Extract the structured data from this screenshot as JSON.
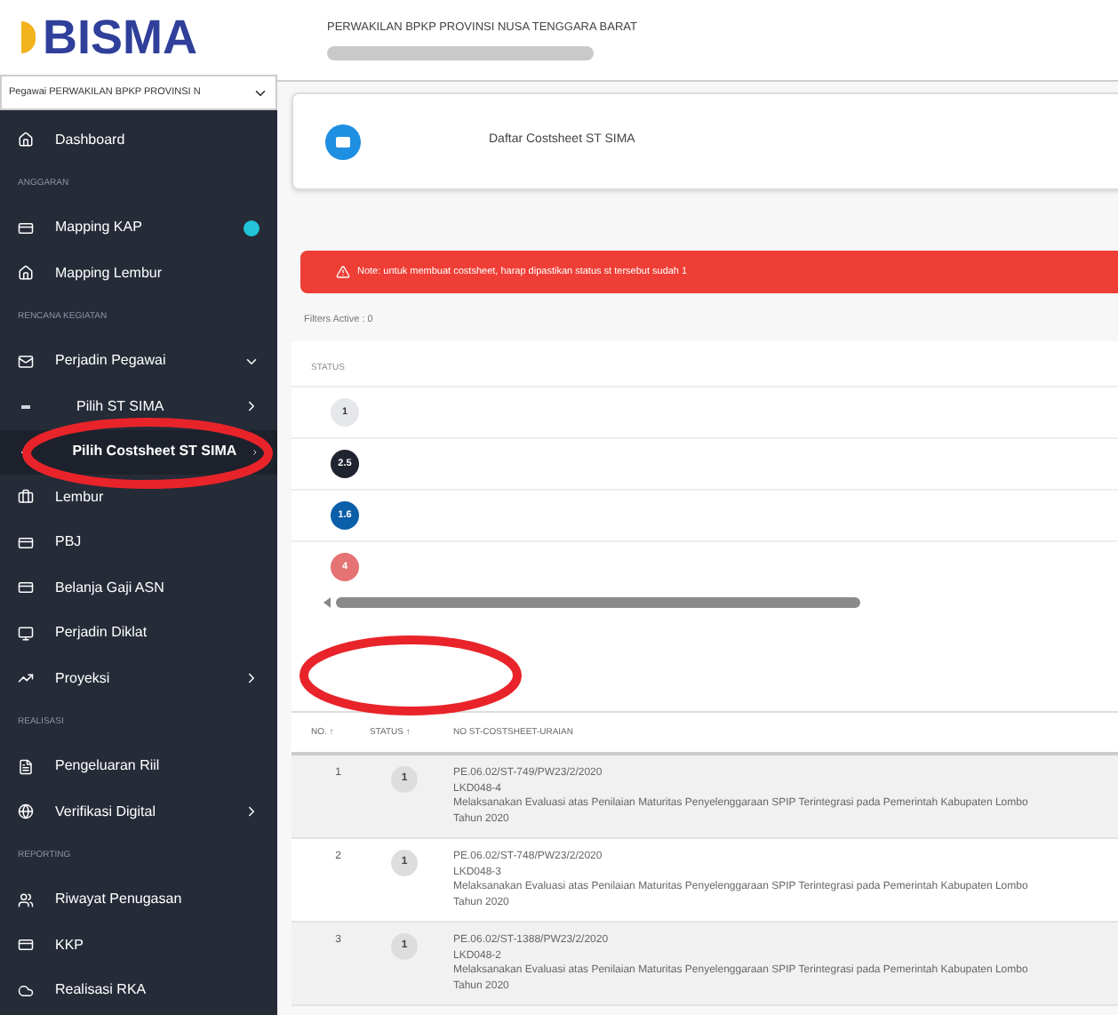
{
  "logo": {
    "text": "BISMA"
  },
  "role_select": {
    "value": "Pegawai PERWAKILAN BPKP PROVINSI N"
  },
  "sidebar": {
    "entries": [
      {
        "kind": "item",
        "label": "Dashboard",
        "selected": false
      },
      {
        "kind": "section",
        "label": "ANGGARAN"
      },
      {
        "kind": "item",
        "label": "Mapping KAP",
        "selected": false,
        "color": "#22c4d8"
      },
      {
        "kind": "item",
        "label": "Mapping Lembur",
        "selected": false
      },
      {
        "kind": "section",
        "label": "RENCANA KEGIATAN"
      },
      {
        "kind": "item",
        "label": "Perjadin Pegawai",
        "selected": false,
        "expanded": true,
        "children": [
          {
            "label": "Pilih ST SIMA",
            "selected": false
          },
          {
            "label": "Pilih Costsheet ST SIMA",
            "selected": true
          }
        ]
      },
      {
        "kind": "item",
        "label": "Lembur",
        "selected": false
      },
      {
        "kind": "item",
        "label": "PBJ",
        "selected": false
      },
      {
        "kind": "item",
        "label": "Belanja Gaji ASN",
        "selected": false
      },
      {
        "kind": "item",
        "label": "Perjadin Diklat",
        "selected": false
      },
      {
        "kind": "item",
        "label": "Proyeksi",
        "selected": false,
        "expanded": false
      },
      {
        "kind": "section",
        "label": "REALISASI"
      },
      {
        "kind": "item",
        "label": "Pengeluaran Riil",
        "selected": false
      },
      {
        "kind": "item",
        "label": "Verifikasi Digital",
        "selected": false,
        "expanded": false
      },
      {
        "kind": "section",
        "label": "REPORTING"
      },
      {
        "kind": "item",
        "label": "Riwayat Penugasan",
        "selected": false
      },
      {
        "kind": "item",
        "label": "KKP",
        "selected": false
      },
      {
        "kind": "item",
        "label": "Realisasi RKA",
        "selected": false
      }
    ]
  },
  "header": {
    "office": "PERWAKILAN BPKP PROVINSI NUSA TENGGARA BARAT"
  },
  "page_card": {
    "title": "Daftar Costsheet ST SIMA"
  },
  "alert": {
    "text": "Note: untuk membuat costsheet, harap dipastikan status st tersebut sudah 1"
  },
  "filters": {
    "text": "Filters Active : 0"
  },
  "status_legend": {
    "heading": "STATUS",
    "badges": [
      {
        "text": "1",
        "color": "#e5e7eb"
      },
      {
        "text": "2.5",
        "color": "#1f2430"
      },
      {
        "text": "1.6",
        "color": "#0b5ea8"
      },
      {
        "text": "4",
        "color": "#e57373"
      }
    ]
  },
  "table": {
    "columns": [
      "NO. ↑",
      "STATUS ↑",
      "NO ST-COSTSHEET-URAIAN"
    ],
    "rows": [
      {
        "no": "1",
        "status": "1",
        "st": "PE.06.02/ST-749/PW23/2/2020",
        "costsheet": "LKD048-4",
        "uraian": "Melaksanakan Evaluasi atas Penilaian Maturitas Penyelenggaraan SPIP Terintegrasi pada Pemerintah Kabupaten Lombo",
        "year": "Tahun 2020"
      },
      {
        "no": "2",
        "status": "1",
        "st": "PE.06.02/ST-748/PW23/2/2020",
        "costsheet": "LKD048-3",
        "uraian": "Melaksanakan Evaluasi atas Penilaian Maturitas Penyelenggaraan SPIP Terintegrasi pada Pemerintah Kabupaten Lombo",
        "year": "Tahun 2020"
      },
      {
        "no": "3",
        "status": "1",
        "st": "PE.06.02/ST-1388/PW23/2/2020",
        "costsheet": "LKD048-2",
        "uraian": "Melaksanakan Evaluasi atas Penilaian Maturitas Penyelenggaraan SPIP Terintegrasi pada Pemerintah Kabupaten Lombo",
        "year": "Tahun 2020"
      }
    ]
  }
}
